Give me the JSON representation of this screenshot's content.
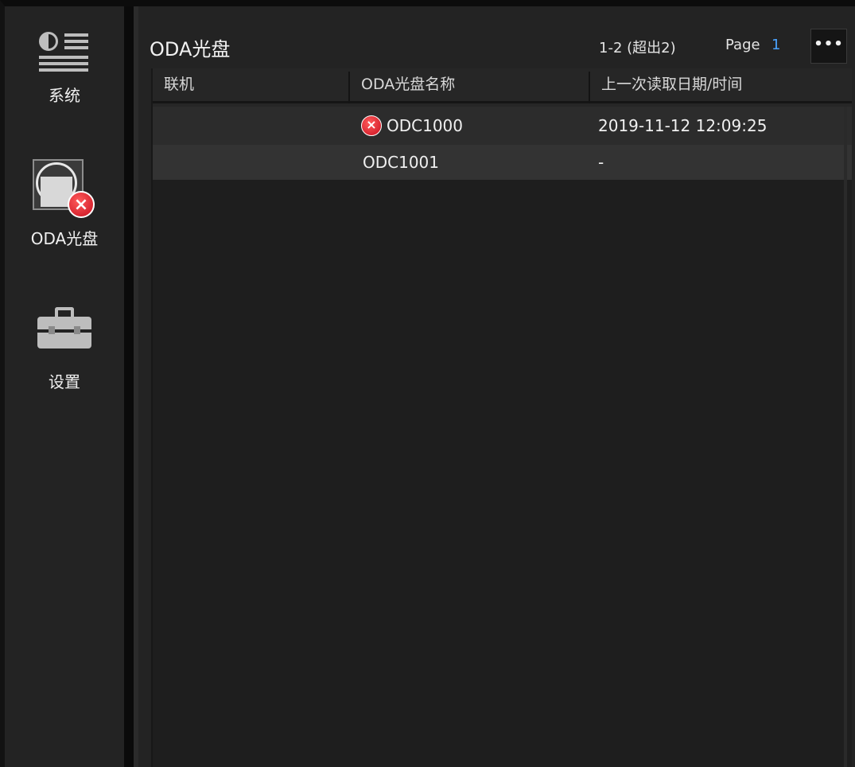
{
  "sidebar": {
    "items": [
      {
        "label": "系统",
        "icon": "system-list-icon"
      },
      {
        "label": "ODA光盘",
        "icon": "disc-error-icon"
      },
      {
        "label": "设置",
        "icon": "toolbox-icon"
      }
    ]
  },
  "main": {
    "title": "ODA光盘",
    "pager": {
      "range": "1-2 (超出2)",
      "page_word": "Page",
      "page_number": "1",
      "more_label": "•••"
    },
    "table": {
      "columns": [
        "联机",
        "ODA光盘名称",
        "上一次读取日期/时间"
      ],
      "rows": [
        {
          "online": "",
          "name": "ODC1000",
          "has_error": true,
          "last_read": "2019-11-12 12:09:25"
        },
        {
          "online": "",
          "name": "ODC1001",
          "has_error": false,
          "last_read": "-"
        }
      ]
    }
  },
  "icons": {
    "error_badge": "×"
  },
  "colors": {
    "accent": "#4aa3ff",
    "error": "#d0182a",
    "background": "#232323"
  }
}
